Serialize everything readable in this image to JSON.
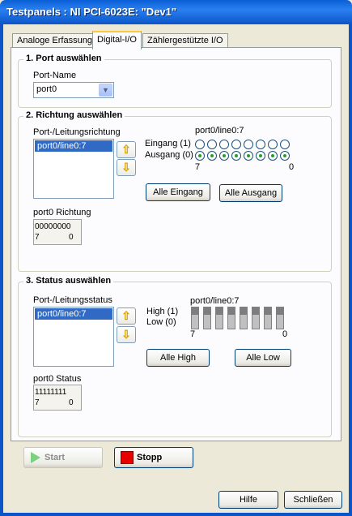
{
  "window": {
    "title": "Testpanels : NI PCI-6023E: \"Dev1\""
  },
  "tabs": [
    {
      "label": "Analoge Erfassung"
    },
    {
      "label": "Digital-I/O"
    },
    {
      "label": "Zählergestützte I/O"
    }
  ],
  "port_section": {
    "title": "1. Port auswählen",
    "name_label": "Port-Name",
    "selected_port": "port0"
  },
  "direction_section": {
    "title": "2. Richtung auswählen",
    "list_label": "Port-/Leitungsrichtung",
    "list_items": [
      "port0/line0:7"
    ],
    "lines_label": "port0/line0:7",
    "input_label": "Eingang (1)",
    "output_label": "Ausgang (0)",
    "input_states": [
      false,
      false,
      false,
      false,
      false,
      false,
      false,
      false
    ],
    "output_states": [
      true,
      true,
      true,
      true,
      true,
      true,
      true,
      true
    ],
    "high_index": "7",
    "low_index": "0",
    "all_input_label": "Alle Eingang",
    "all_output_label": "Alle Ausgang",
    "value_label": "port0 Richtung",
    "value": "00000000",
    "value_high": "7",
    "value_low": "0"
  },
  "status_section": {
    "title": "3. Status auswählen",
    "list_label": "Port-/Leitungsstatus",
    "list_items": [
      "port0/line0:7"
    ],
    "lines_label": "port0/line0:7",
    "high_label": "High (1)",
    "low_label": "Low (0)",
    "high_index": "7",
    "low_index": "0",
    "all_high_label": "Alle High",
    "all_low_label": "Alle Low",
    "value_label": "port0 Status",
    "value": "11111111",
    "value_high": "7",
    "value_low": "0"
  },
  "controls": {
    "start_label": "Start",
    "stop_label": "Stopp"
  },
  "footer": {
    "help_label": "Hilfe",
    "close_label": "Schließen"
  }
}
